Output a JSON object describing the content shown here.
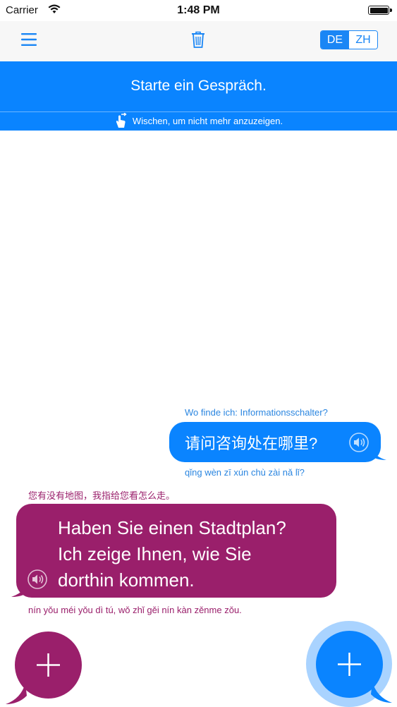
{
  "status_bar": {
    "carrier": "Carrier",
    "time": "1:48 PM",
    "battery_level": 1.0
  },
  "nav": {
    "menu_icon": "hamburger-menu-icon",
    "trash_icon": "trash-icon",
    "lang_left": "DE",
    "lang_right": "ZH",
    "active_lang": "DE"
  },
  "banner": {
    "title": "Starte ein Gespräch.",
    "hint": "Wischen, um nicht mehr anzuzeigen.",
    "hint_icon": "swipe-hand-icon"
  },
  "messages": [
    {
      "side": "right",
      "color": "#0a84ff",
      "source": "Wo finde ich: Informationsschalter?",
      "translation": "请问咨询处在哪里?",
      "pinyin": "qǐng wèn zī xún chù zài nǎ lǐ?"
    },
    {
      "side": "left",
      "color": "#9a1f6b",
      "source": "您有没有地图，我指给您看怎么走。",
      "translation_lines": [
        "Haben Sie einen Stadtplan?",
        "Ich zeige Ihnen, wie Sie",
        "dorthin kommen."
      ],
      "pinyin": "nín yǒu méi yǒu dì tú, wǒ zhǐ gěi nín kàn zěnme zǒu."
    }
  ],
  "fab_left_icon": "plus-icon",
  "fab_right_icon": "plus-icon",
  "colors": {
    "blue": "#0a84ff",
    "purple": "#9a1f6b",
    "nav_bg": "#f7f7f7"
  }
}
